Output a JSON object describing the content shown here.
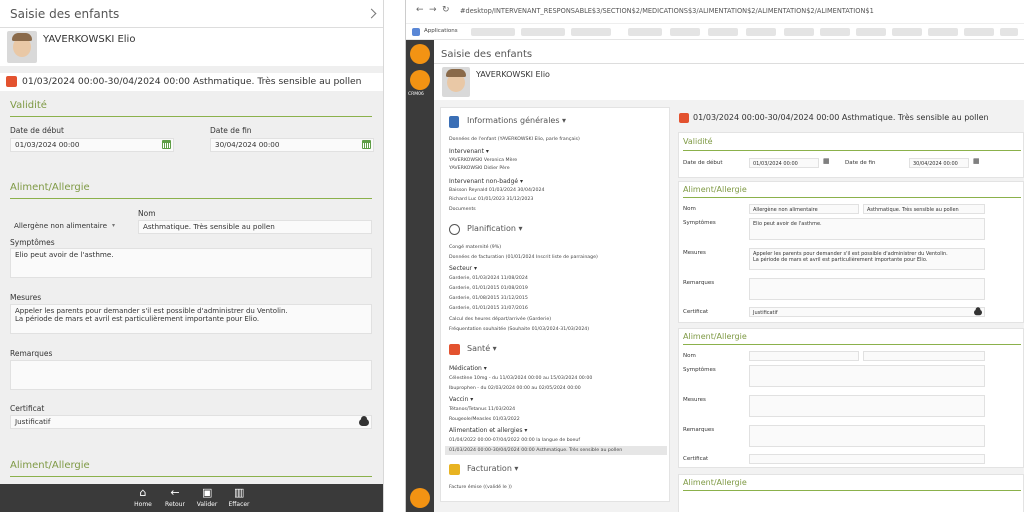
{
  "mobile": {
    "title": "Saisie des enfants",
    "child_name": "YAVERKOWSKI Elio",
    "allergy_entry": "01/03/2024 00:00-30/04/2024 00:00 Asthmatique. Très sensible au pollen",
    "validity_title": "Validité",
    "start_label": "Date de début",
    "start_value": "01/03/2024 00:00",
    "end_label": "Date de fin",
    "end_value": "30/04/2024 00:00",
    "section_title": "Aliment/Allergie",
    "type_value": "Allergène non alimentaire",
    "name_label": "Nom",
    "name_value": "Asthmatique. Très sensible au pollen",
    "symptoms_label": "Symptômes",
    "symptoms_value": "Elio peut avoir de l'asthme.",
    "measures_label": "Mesures",
    "measures_line1": "Appeler les parents pour demander s'il est possible d'administrer du Ventolin.",
    "measures_line2": "La période de mars et avril est particulièrement importante pour Elio.",
    "remarks_label": "Remarques",
    "cert_label": "Certificat",
    "cert_value": "Justificatif",
    "section2_title": "Aliment/Allergie",
    "nav": {
      "home": "Home",
      "back": "Retour",
      "save": "Valider",
      "delete": "Effacer"
    }
  },
  "desktop": {
    "url": "#desktop/INTERVENANT_RESPONSABLE$3/SECTION$2/MEDICATIONS$3/ALIMENTATION$2/ALIMENTATION$2/ALIMENTATION$1",
    "bookmark_apps": "Applications",
    "rail_label": "CRM06",
    "title": "Saisie des enfants",
    "child_name": "YAVERKOWSKI Elio",
    "left": {
      "info_title": "Informations générales",
      "info_line": "Données de l'enfant (YAVERKOWSKI Elio, parle français)",
      "intervenant_label": "Intervenant",
      "int1": "YAVERKOWSKI Veronica Mère",
      "int2": "YAVERKOWSKI Didier Père",
      "nonbadge_label": "Intervenant non-badgé",
      "nb1": "Baisson Reynald 01/03/2024 30/04/2024",
      "nb2": "Richard Luc 01/01/2023 31/12/2023",
      "docs": "Documents",
      "plan_title": "Planification",
      "p1": "Congé maternité (9%)",
      "p2": "Données de facturation (01/01/2024 Inscrit liste de parrainage)",
      "secteur_label": "Secteur",
      "s1": "Garderie, 01/03/2024 11/08/2024",
      "s2": "Garderie, 01/01/2015 01/08/2019",
      "s3": "Garderie, 01/08/2015 31/12/2015",
      "s4": "Garderie, 01/01/2015 31/07/2016",
      "s5": "Calcul des heures départ/arrivée (Garderie)",
      "s6": "Fréquentation souhaitée (Souhaite 01/03/2024-31/03/2024)",
      "sante_title": "Santé",
      "med_label": "Médication",
      "m1": "Célestène 10mg - du 11/03/2024 00:00 au 15/03/2024 00:00",
      "m2": "Ibuprophen - du 02/03/2024 00:00 au 02/05/2024 00:00",
      "vac_label": "Vaccin",
      "v1": "Tétanos/Tetanus 11/03/2024",
      "v2": "Rougeole/Measles 01/03/2022",
      "alim_label": "Alimentation et allergies",
      "a1": "01/04/2022 00:00-07/04/2022 00:00 la langue de boeuf",
      "a2": "01/03/2024 00:00-30/04/2024 00:00 Asthmatique. Très sensible au pollen",
      "fact_title": "Facturation",
      "f1": "Facture émise ((validé le ))"
    },
    "right": {
      "header": "01/03/2024 00:00-30/04/2024 00:00 Asthmatique. Très sensible au pollen",
      "validity_title": "Validité",
      "start_label": "Date de début",
      "start_value": "01/03/2024 00:00",
      "end_label": "Date de fin",
      "end_value": "30/04/2024 00:00",
      "section_title": "Aliment/Allergie",
      "nom_label": "Nom",
      "type_value": "Allergène non alimentaire",
      "name_value": "Asthmatique. Très sensible au pollen",
      "symptoms_label": "Symptômes",
      "symptoms_value": "Elio peut avoir de l'asthme.",
      "measures_label": "Mesures",
      "measures_line1": "Appeler les parents pour demander s'il est possible d'administrer du Ventolin.",
      "measures_line2": "La période de mars et avril est particulièrement importante pour Elio.",
      "remarks_label": "Remarques",
      "cert_label": "Certificat",
      "cert_value": "Justificatif",
      "section2_title": "Aliment/Allergie",
      "s2_nom": "Nom",
      "s2_symptoms": "Symptômes",
      "s2_measures": "Mesures",
      "s2_remarks": "Remarques",
      "s2_cert": "Certificat",
      "section3_title": "Aliment/Allergie"
    }
  }
}
